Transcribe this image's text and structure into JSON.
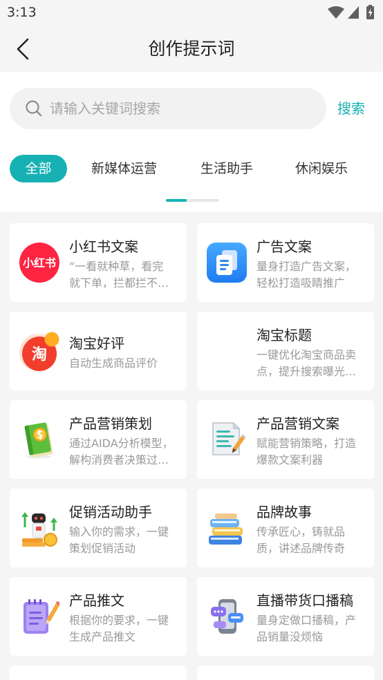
{
  "status_bar": {
    "time": "3:13",
    "icons": [
      "wifi-icon",
      "signal-icon",
      "battery-charging-icon"
    ]
  },
  "header": {
    "title": "创作提示词",
    "back_icon": "chevron-left-icon"
  },
  "search": {
    "placeholder": "请输入关键词搜索",
    "button_label": "搜索",
    "icon": "search-icon"
  },
  "tabs": [
    {
      "label": "全部",
      "selected": true
    },
    {
      "label": "新媒体运营",
      "selected": false
    },
    {
      "label": "生活助手",
      "selected": false
    },
    {
      "label": "休闲娱乐",
      "selected": false
    }
  ],
  "tab_scroll": {
    "thumb_fraction": 0.39
  },
  "colors": {
    "accent": "#17b1b3",
    "page_bg": "#f5f5f5",
    "card_bg": "#ffffff",
    "title_text": "#222222",
    "desc_text": "#999999"
  },
  "cards": [
    {
      "title": "小红书文案",
      "desc": [
        "“一看就种草，看完",
        "就下单，拦都拦不…"
      ],
      "icon": "xiaohongshu-logo-icon",
      "logo_text": "小红书"
    },
    {
      "title": "广告文案",
      "desc": [
        "量身打造广告文案，",
        "轻松打造吸睛推广"
      ],
      "icon": "documents-icon"
    },
    {
      "title": "淘宝好评",
      "desc": [
        "自动生成商品评价"
      ],
      "icon": "taobao-logo-icon",
      "logo_text": "淘"
    },
    {
      "title": "淘宝标题",
      "desc": [
        "一键优化淘宝商品卖",
        "点，提升搜索曝光…"
      ]
    },
    {
      "title": "产品营销策划",
      "desc": [
        "通过AIDA分析模型，",
        "解构消费者决策过…"
      ],
      "icon": "money-book-icon"
    },
    {
      "title": "产品营销文案",
      "desc": [
        "赋能营销策略，打造",
        "爆款文案利器"
      ],
      "icon": "document-pencil-icon"
    },
    {
      "title": "促销活动助手",
      "desc": [
        "输入你的需求，一键",
        "策划促销活动"
      ],
      "icon": "robot-coins-icon"
    },
    {
      "title": "品牌故事",
      "desc": [
        "传承匠心，铸就品",
        "质，讲述品牌传奇"
      ],
      "icon": "book-stack-icon"
    },
    {
      "title": "产品推文",
      "desc": [
        "根据你的要求，一键",
        "生成产品推文"
      ],
      "icon": "notepad-pencil-icon"
    },
    {
      "title": "直播带货口播稿",
      "desc": [
        "量身定做口播稿，产",
        "品销量没烦恼"
      ],
      "icon": "phone-chat-icon"
    }
  ]
}
